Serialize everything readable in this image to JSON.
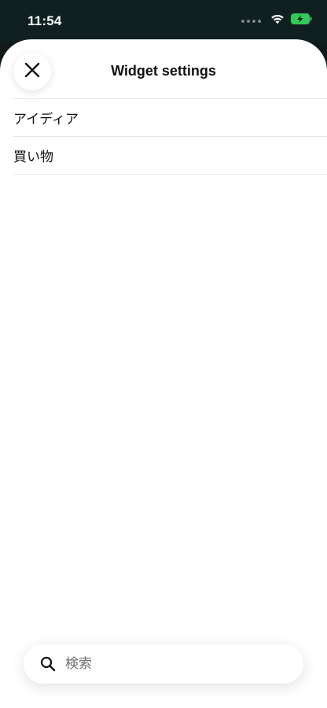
{
  "status_bar": {
    "time": "11:54"
  },
  "header": {
    "title": "Widget settings",
    "close_icon": "close-icon"
  },
  "list": {
    "items": [
      {
        "label": "アイディア"
      },
      {
        "label": "買い物"
      }
    ]
  },
  "search": {
    "placeholder": "検索",
    "value": "",
    "icon": "search-icon"
  },
  "colors": {
    "status_bar_bg": "#102020",
    "sheet_bg": "#ffffff",
    "divider": "#e6e6e6",
    "battery_accent": "#34c759"
  }
}
